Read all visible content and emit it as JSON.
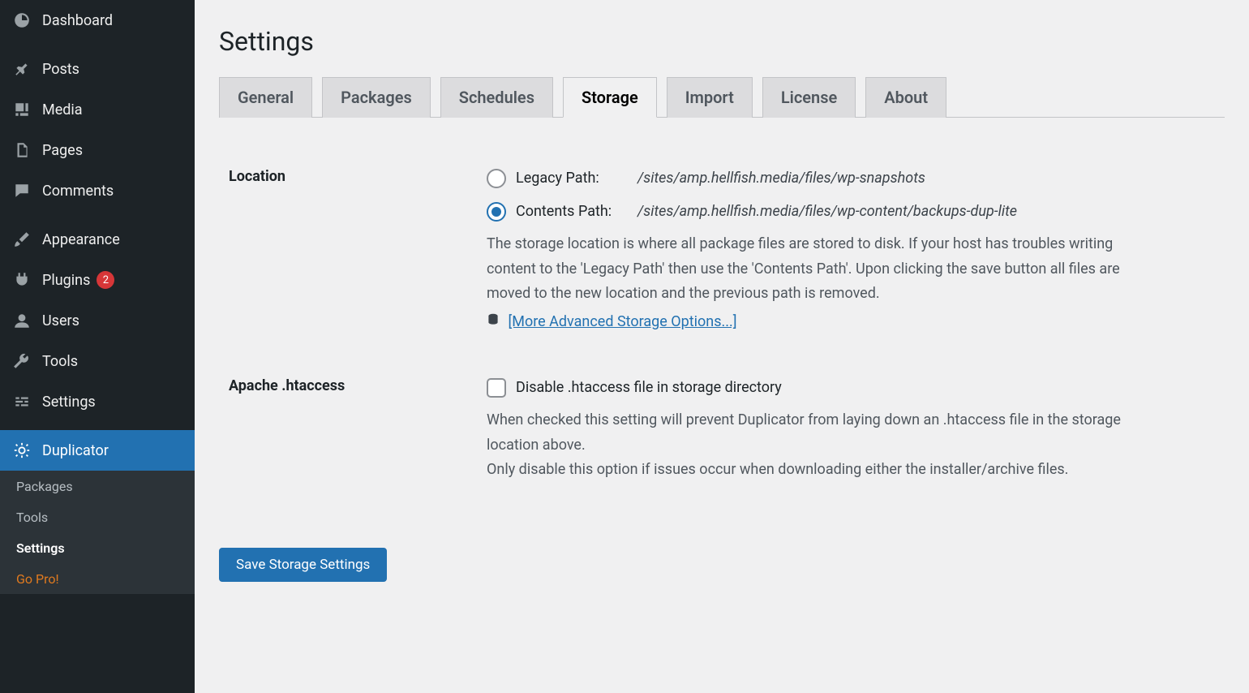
{
  "sidebar": {
    "dashboard": "Dashboard",
    "posts": "Posts",
    "media": "Media",
    "pages": "Pages",
    "comments": "Comments",
    "appearance": "Appearance",
    "plugins": "Plugins",
    "plugins_count": "2",
    "users": "Users",
    "tools": "Tools",
    "settings": "Settings",
    "duplicator": "Duplicator",
    "sub": {
      "packages": "Packages",
      "tools": "Tools",
      "settings": "Settings",
      "gopro": "Go Pro!"
    }
  },
  "page": {
    "title": "Settings",
    "tabs": {
      "general": "General",
      "packages": "Packages",
      "schedules": "Schedules",
      "storage": "Storage",
      "import": "Import",
      "license": "License",
      "about": "About"
    }
  },
  "form": {
    "location": {
      "label": "Location",
      "legacy_label": "Legacy Path:",
      "legacy_value": "/sites/amp.hellfish.media/files/wp-snapshots",
      "contents_label": "Contents Path:",
      "contents_value": "/sites/amp.hellfish.media/files/wp-content/backups-dup-lite",
      "desc": "The storage location is where all package files are stored to disk. If your host has troubles writing content to the 'Legacy Path' then use the 'Contents Path'. Upon clicking the save button all files are moved to the new location and the previous path is removed.",
      "more_link": "[More Advanced Storage Options...]"
    },
    "htaccess": {
      "label": "Apache .htaccess",
      "checkbox_label": "Disable .htaccess file in storage directory",
      "desc1": "When checked this setting will prevent Duplicator from laying down an .htaccess file in the storage location above.",
      "desc2": "Only disable this option if issues occur when downloading either the installer/archive files."
    },
    "submit": "Save Storage Settings"
  }
}
